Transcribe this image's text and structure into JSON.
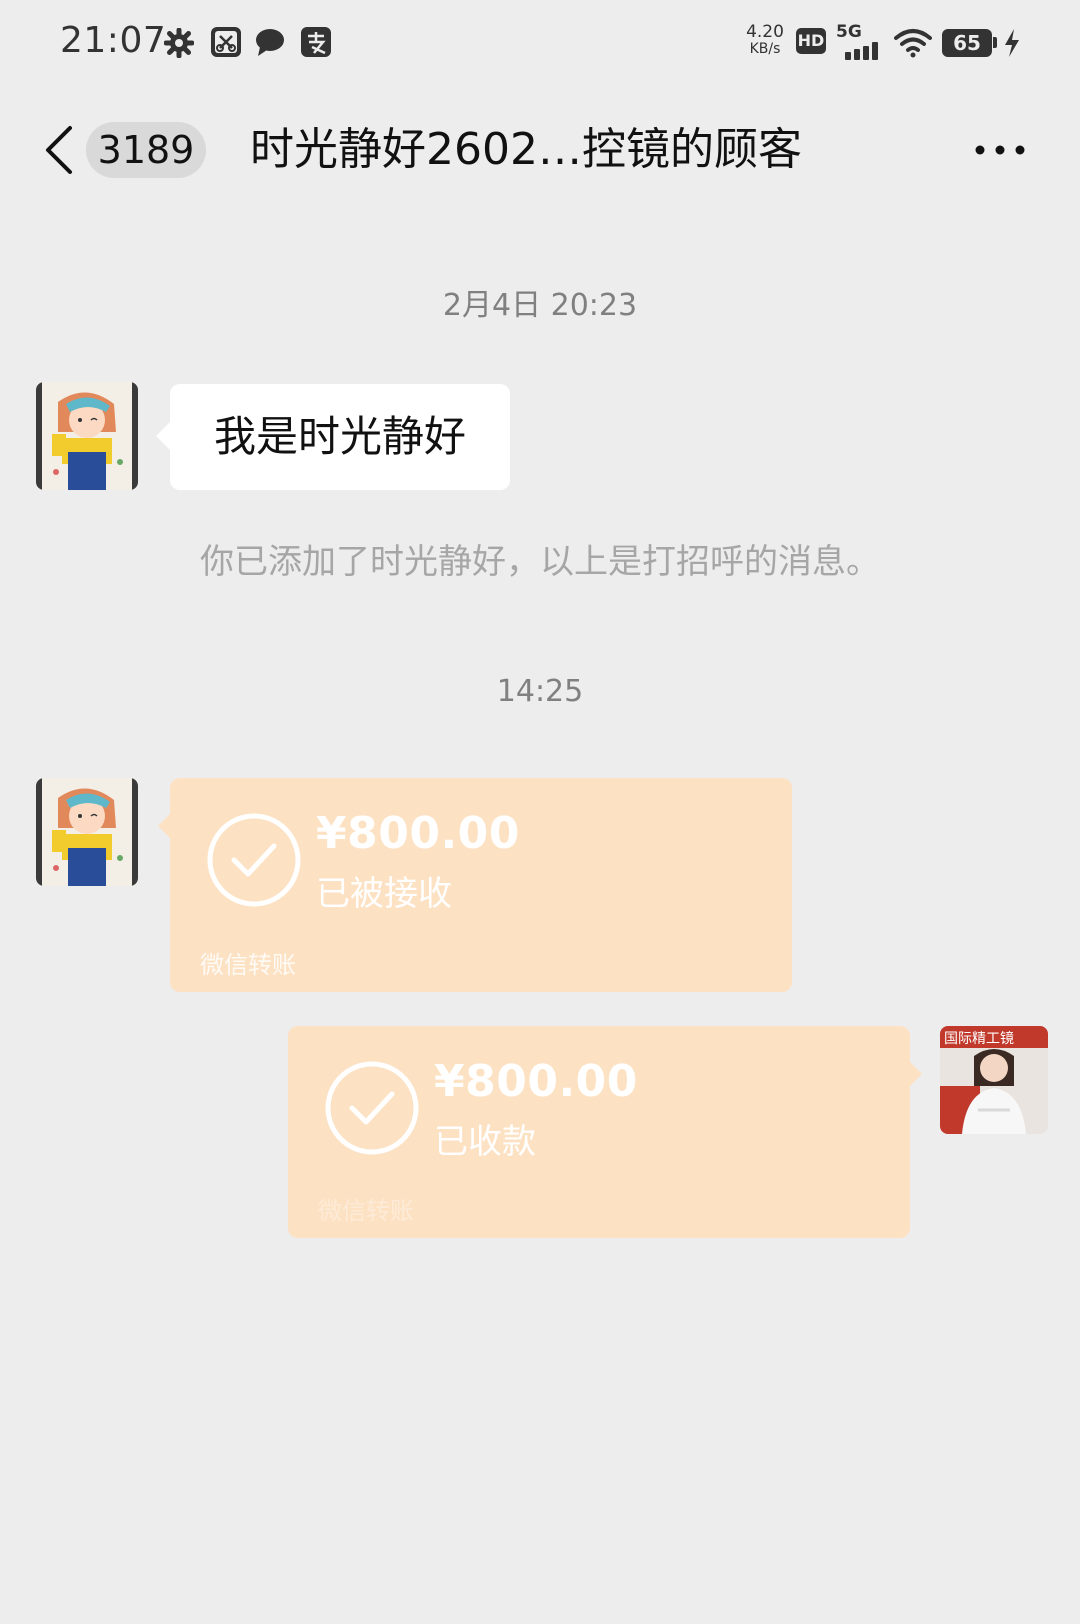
{
  "status_bar": {
    "time": "21:07",
    "speed_value": "4.20",
    "speed_unit": "KB/s",
    "hd": "HD",
    "network": "5G",
    "battery": "65",
    "icons": [
      "gear-icon",
      "scissors-app-icon",
      "chat-bubble-icon",
      "alipay-icon",
      "signal-icon",
      "wifi-icon",
      "charging-icon"
    ]
  },
  "header": {
    "unread_count": "3189",
    "title": "时光静好2602…控镜的顾客",
    "icons": [
      "back-arrow-icon",
      "more-icon"
    ]
  },
  "chat": {
    "timestamp_1": "2月4日 20:23",
    "greeting_message": "我是时光静好",
    "system_message": "你已添加了时光静好，以上是打招呼的消息。",
    "timestamp_2": "14:25",
    "transfer_received": {
      "amount": "¥800.00",
      "status": "已被接收",
      "footer": "微信转账"
    },
    "transfer_sent": {
      "amount": "¥800.00",
      "status": "已收款",
      "footer": "微信转账"
    },
    "self_avatar_sign": "国际精工镜"
  },
  "colors": {
    "background": "#ededed",
    "bubble": "#ffffff",
    "transfer_bubble": "#fde1c3",
    "meta_text": "#808080"
  }
}
